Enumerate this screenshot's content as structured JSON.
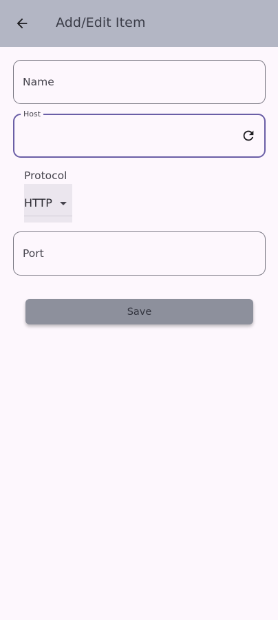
{
  "appbar": {
    "title": "Add/Edit Item",
    "back_icon": "arrow-left-icon"
  },
  "form": {
    "name": {
      "label": "Name",
      "value": ""
    },
    "host": {
      "label": "Host",
      "value": "",
      "trailing_icon": "refresh-icon"
    },
    "protocol": {
      "label": "Protocol",
      "selected": "HTTP"
    },
    "port": {
      "label": "Port",
      "value": ""
    },
    "save_label": "Save"
  },
  "colors": {
    "appbar": "#b3b6c4",
    "background": "#fdf7fd",
    "focus_border": "#6a5ea6",
    "save_button": "#8d909c"
  }
}
